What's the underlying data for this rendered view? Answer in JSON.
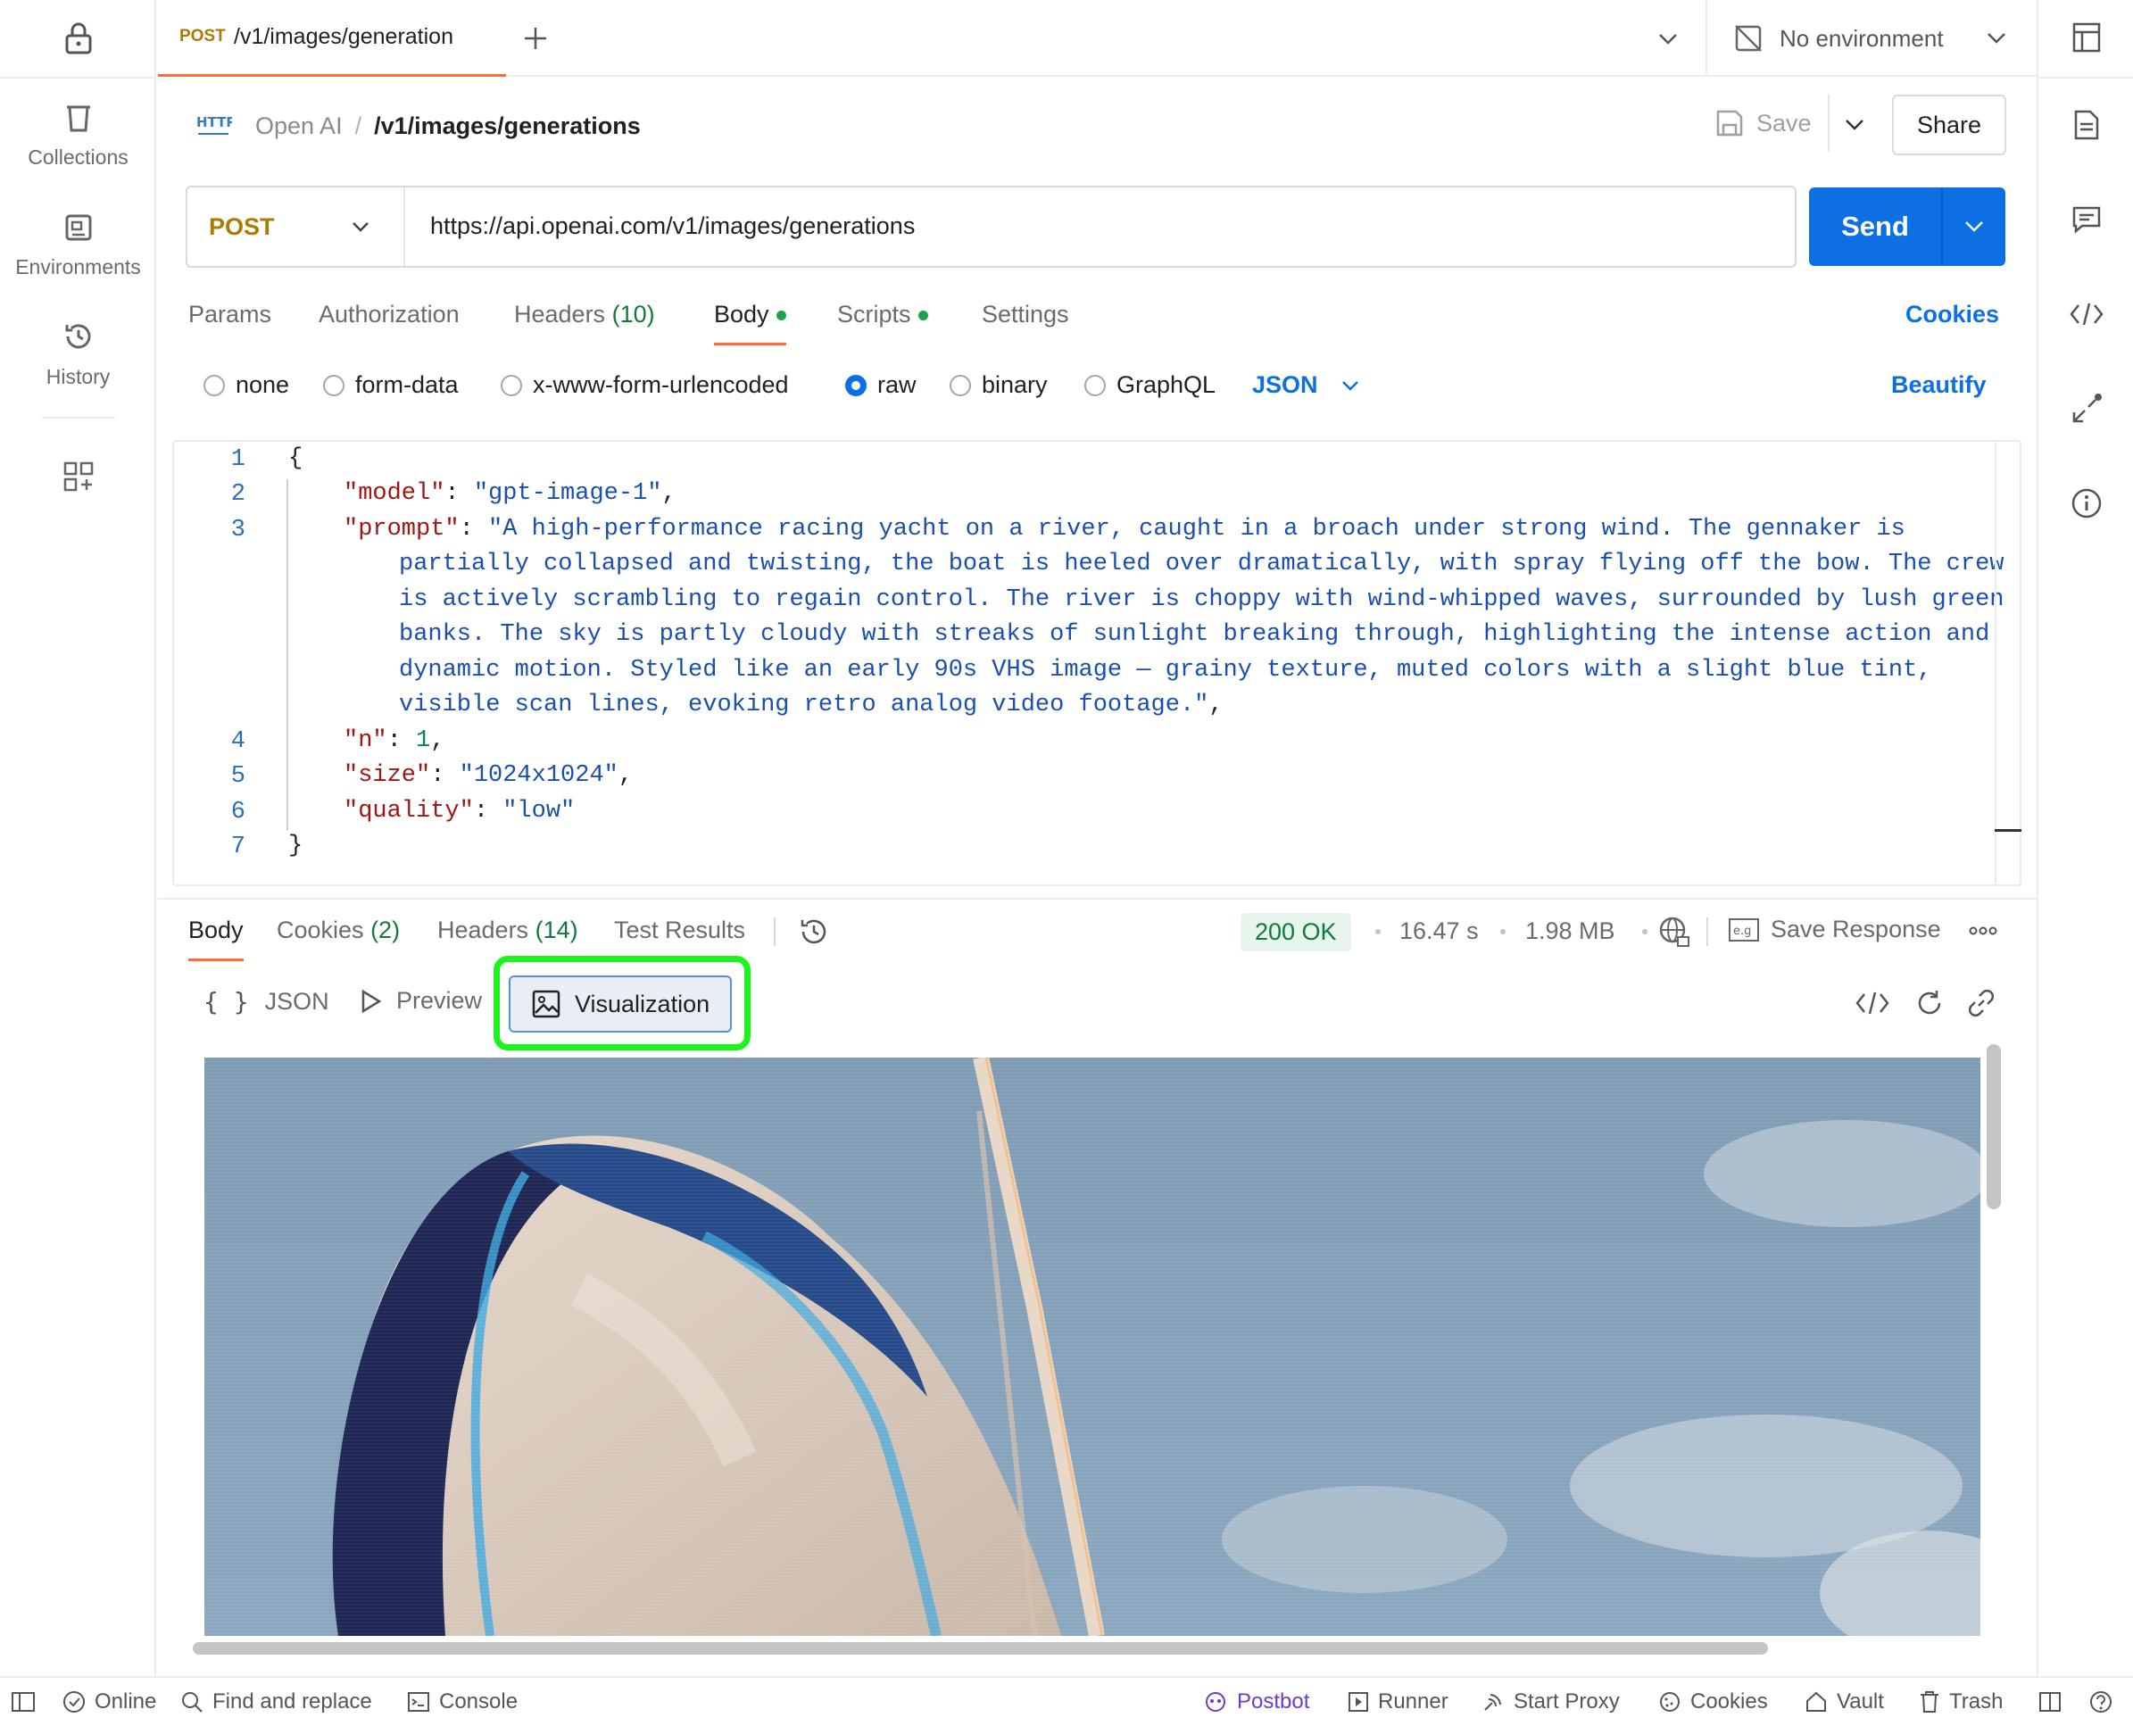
{
  "tab": {
    "method": "POST",
    "title": "/v1/images/generation"
  },
  "environment": {
    "label": "No environment"
  },
  "sidebar": {
    "items": [
      {
        "label": "Collections",
        "icon": "trash-bin-icon"
      },
      {
        "label": "Environments",
        "icon": "environments-icon"
      },
      {
        "label": "History",
        "icon": "history-icon"
      }
    ]
  },
  "header": {
    "protocol": "HTTP",
    "collection": "Open AI",
    "separator": "/",
    "request_name": "/v1/images/generations",
    "save_label": "Save",
    "share_label": "Share"
  },
  "request": {
    "method": "POST",
    "url": "https://api.openai.com/v1/images/generations",
    "send_label": "Send"
  },
  "req_tabs": {
    "params": "Params",
    "authorization": "Authorization",
    "headers": "Headers",
    "headers_count": "(10)",
    "body": "Body",
    "scripts": "Scripts",
    "settings": "Settings",
    "cookies": "Cookies"
  },
  "body_options": {
    "none": "none",
    "form_data": "form-data",
    "urlencoded": "x-www-form-urlencoded",
    "raw": "raw",
    "binary": "binary",
    "graphql": "GraphQL",
    "format": "JSON",
    "beautify": "Beautify"
  },
  "editor": {
    "line_numbers": [
      "1",
      "2",
      "3",
      "4",
      "5",
      "6",
      "7"
    ],
    "open_brace": "{",
    "close_brace": "}",
    "model_key": "\"model\"",
    "model_val": "\"gpt-image-1\"",
    "prompt_key": "\"prompt\"",
    "prompt_lines": [
      "\"A high-performance racing yacht on a river, caught in a broach under strong wind. The gennaker is",
      "partially collapsed and twisting, the boat is heeled over dramatically, with spray flying off the bow. The crew",
      "is actively scrambling to regain control. The river is choppy with wind-whipped waves, surrounded by lush green",
      "banks. The sky is partly cloudy with streaks of sunlight breaking through, highlighting the intense action and",
      "dynamic motion. Styled like an early 90s VHS image — grainy texture, muted colors with a slight blue tint,",
      "visible scan lines, evoking retro analog video footage.\""
    ],
    "n_key": "\"n\"",
    "n_val": "1",
    "size_key": "\"size\"",
    "size_val": "\"1024x1024\"",
    "quality_key": "\"quality\"",
    "quality_val": "\"low\""
  },
  "response": {
    "tabs": {
      "body": "Body",
      "cookies": "Cookies",
      "cookies_count": "(2)",
      "headers": "Headers",
      "headers_count": "(14)",
      "tests": "Test Results"
    },
    "status": "200 OK",
    "time": "16.47 s",
    "size": "1.98 MB",
    "save_response": "Save Response",
    "views": {
      "json": "JSON",
      "preview": "Preview",
      "visualization": "Visualization"
    }
  },
  "statusbar": {
    "online": "Online",
    "find_replace": "Find and replace",
    "console": "Console",
    "postbot": "Postbot",
    "runner": "Runner",
    "start_proxy": "Start Proxy",
    "cookies": "Cookies",
    "vault": "Vault",
    "trash": "Trash"
  },
  "colors": {
    "accent": "#0c6fe3",
    "brand_orange": "#ff6c37",
    "method_post": "#ad7a03",
    "highlight": "#1bf51b",
    "status_ok": "#0f7b3b"
  }
}
